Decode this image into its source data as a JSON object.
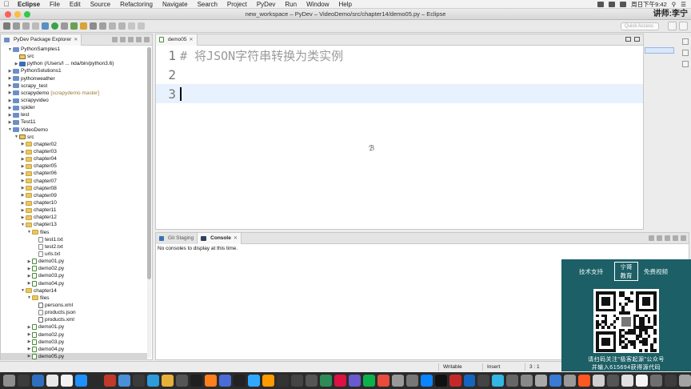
{
  "menubar": {
    "app": "Eclipse",
    "items": [
      "File",
      "Edit",
      "Source",
      "Refactoring",
      "Navigate",
      "Search",
      "Project",
      "PyDev",
      "Run",
      "Window",
      "Help"
    ],
    "clock": "周日下午9:42"
  },
  "window": {
    "title": "new_workspace – PyDev – VideoDemo/src/chapter14/demo05.py – Eclipse",
    "overlay_label": "讲师:",
    "overlay_name": "李宁"
  },
  "toolbar": {
    "quick_access": "Quick Access"
  },
  "explorer": {
    "tab_title": "PyDev Package Explorer",
    "tree": [
      {
        "indent": 1,
        "expanded": true,
        "kind": "project",
        "label": "PythonSamples1"
      },
      {
        "indent": 2,
        "expanded": null,
        "kind": "srcfolder",
        "label": "src"
      },
      {
        "indent": 2,
        "expanded": false,
        "kind": "lib",
        "label": "python  (/Users/l ... nda/bin/python3.6)"
      },
      {
        "indent": 1,
        "expanded": false,
        "kind": "project",
        "label": "PythonSolutions1"
      },
      {
        "indent": 1,
        "expanded": false,
        "kind": "project",
        "label": "pythonweather"
      },
      {
        "indent": 1,
        "expanded": false,
        "kind": "project",
        "label": "scrapy_test"
      },
      {
        "indent": 1,
        "expanded": false,
        "kind": "project",
        "label": "scrapydemo",
        "decor": "[scrapydemo master]"
      },
      {
        "indent": 1,
        "expanded": false,
        "kind": "project",
        "label": "scrapyvideo"
      },
      {
        "indent": 1,
        "expanded": false,
        "kind": "project",
        "label": "spider"
      },
      {
        "indent": 1,
        "expanded": false,
        "kind": "project",
        "label": "test"
      },
      {
        "indent": 1,
        "expanded": false,
        "kind": "project",
        "label": "Test11"
      },
      {
        "indent": 1,
        "expanded": true,
        "kind": "project",
        "label": "VideoDemo"
      },
      {
        "indent": 2,
        "expanded": true,
        "kind": "srcfolder",
        "label": "src"
      },
      {
        "indent": 3,
        "expanded": false,
        "kind": "folder",
        "label": "chapter02"
      },
      {
        "indent": 3,
        "expanded": false,
        "kind": "folder",
        "label": "chapter03"
      },
      {
        "indent": 3,
        "expanded": false,
        "kind": "folder",
        "label": "chapter04"
      },
      {
        "indent": 3,
        "expanded": false,
        "kind": "folder",
        "label": "chapter05"
      },
      {
        "indent": 3,
        "expanded": false,
        "kind": "folder",
        "label": "chapter06"
      },
      {
        "indent": 3,
        "expanded": false,
        "kind": "folder",
        "label": "chapter07"
      },
      {
        "indent": 3,
        "expanded": false,
        "kind": "folder",
        "label": "chapter08"
      },
      {
        "indent": 3,
        "expanded": false,
        "kind": "folder",
        "label": "chapter09"
      },
      {
        "indent": 3,
        "expanded": false,
        "kind": "folder",
        "label": "chapter10"
      },
      {
        "indent": 3,
        "expanded": false,
        "kind": "folder",
        "label": "chapter11"
      },
      {
        "indent": 3,
        "expanded": false,
        "kind": "folder",
        "label": "chapter12"
      },
      {
        "indent": 3,
        "expanded": true,
        "kind": "folder",
        "label": "chapter13"
      },
      {
        "indent": 4,
        "expanded": true,
        "kind": "folder",
        "label": "files"
      },
      {
        "indent": 5,
        "expanded": null,
        "kind": "file",
        "label": "test1.txt"
      },
      {
        "indent": 5,
        "expanded": null,
        "kind": "file",
        "label": "test2.txt"
      },
      {
        "indent": 5,
        "expanded": null,
        "kind": "file",
        "label": "urls.txt"
      },
      {
        "indent": 4,
        "expanded": false,
        "kind": "py",
        "label": "demo01.py"
      },
      {
        "indent": 4,
        "expanded": false,
        "kind": "py",
        "label": "demo02.py"
      },
      {
        "indent": 4,
        "expanded": false,
        "kind": "py",
        "label": "demo03.py"
      },
      {
        "indent": 4,
        "expanded": false,
        "kind": "py",
        "label": "demo04.py"
      },
      {
        "indent": 3,
        "expanded": true,
        "kind": "folder",
        "label": "chapter14"
      },
      {
        "indent": 4,
        "expanded": true,
        "kind": "folder",
        "label": "files"
      },
      {
        "indent": 5,
        "expanded": null,
        "kind": "xml",
        "label": "persons.xml"
      },
      {
        "indent": 5,
        "expanded": null,
        "kind": "file",
        "label": "products.json"
      },
      {
        "indent": 5,
        "expanded": null,
        "kind": "xml",
        "label": "products.xml"
      },
      {
        "indent": 4,
        "expanded": false,
        "kind": "py",
        "label": "demo01.py"
      },
      {
        "indent": 4,
        "expanded": false,
        "kind": "py",
        "label": "demo02.py"
      },
      {
        "indent": 4,
        "expanded": false,
        "kind": "py",
        "label": "demo03.py"
      },
      {
        "indent": 4,
        "expanded": false,
        "kind": "py",
        "label": "demo04.py"
      },
      {
        "indent": 4,
        "expanded": false,
        "kind": "py",
        "label": "demo05.py",
        "selected": true
      }
    ]
  },
  "editor": {
    "tab_title": "demo05",
    "lines": [
      {
        "number": "1",
        "text": "# 将JSON字符串转换为类实例"
      },
      {
        "number": "2",
        "text": ""
      },
      {
        "number": "3",
        "text": "",
        "current": true
      }
    ]
  },
  "console": {
    "tabs": [
      {
        "label": "Git Staging",
        "active": false
      },
      {
        "label": "Console",
        "active": true
      }
    ],
    "message": "No consoles to display at this time."
  },
  "statusbar": {
    "mode1": "Writable",
    "mode2": "Insert",
    "position": "3 : 1"
  },
  "promo": {
    "left_tab": "技术支持",
    "center_line1": "宁哥",
    "center_line2": "教育",
    "right_tab": "免费视频",
    "line1": "请扫码关注“极客起源”公众号",
    "line2": "并输入615694获得源代码"
  },
  "colors": {
    "current_line": "#e8f2fe",
    "promo_bg": "#1c5f66",
    "selection": "#d6d6d6"
  }
}
